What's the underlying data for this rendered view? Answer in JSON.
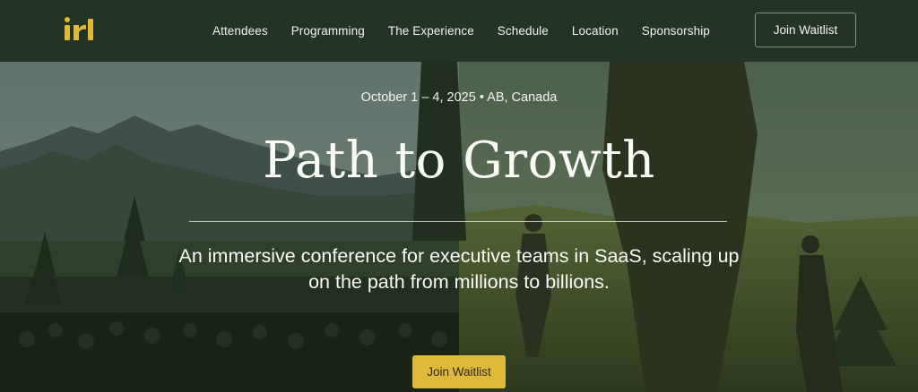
{
  "header": {
    "logo_text": "irl",
    "nav": [
      {
        "label": "Attendees"
      },
      {
        "label": "Programming"
      },
      {
        "label": "The Experience"
      },
      {
        "label": "Schedule"
      },
      {
        "label": "Location"
      },
      {
        "label": "Sponsorship"
      }
    ],
    "cta_label": "Join Waitlist"
  },
  "hero": {
    "date_line": "October 1 – 4, 2025 • AB, Canada",
    "title": "Path to Growth",
    "subtitle": "An immersive conference for executive teams in SaaS, scaling up on the path from millions to billions.",
    "cta_label": "Join Waitlist"
  },
  "colors": {
    "header_bg": "#233326",
    "accent_gold": "#e1b93a",
    "text_light": "#fbfbf6"
  },
  "icons": {
    "logo": "irl-logo"
  }
}
